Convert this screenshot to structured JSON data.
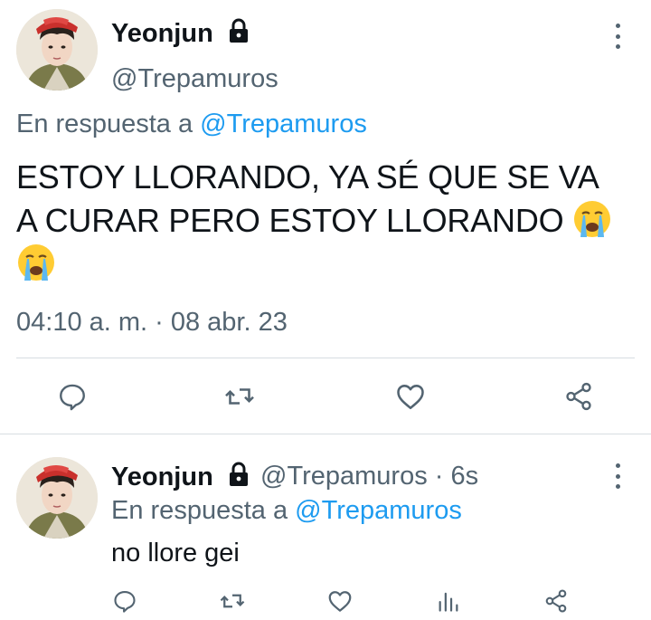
{
  "main_tweet": {
    "author_name": "Yeonjun",
    "author_handle": "@Trepamuros",
    "reply_prefix": "En respuesta a ",
    "reply_mention": "@Trepamuros",
    "text_line1": "ESTOY LLORANDO, YA SÉ QUE SE VA",
    "text_line2": "A CURAR PERO ESTOY LLORANDO",
    "timestamp": "04:10 a. m. · 08 abr. 23",
    "protected": true
  },
  "reply_tweet": {
    "author_name": "Yeonjun",
    "author_handle_time": "@Trepamuros · 6s",
    "reply_prefix": "En respuesta a ",
    "reply_mention": "@Trepamuros",
    "text": "no llore gei",
    "protected": true
  },
  "icons": {
    "more": "more-vertical-icon",
    "lock": "lock-icon",
    "reply": "reply-icon",
    "retweet": "retweet-icon",
    "like": "heart-icon",
    "views": "views-icon",
    "share": "share-icon",
    "emoji": "loudly-crying-face-emoji"
  },
  "colors": {
    "link": "#1d9bf0",
    "secondary_text": "#536471",
    "primary_text": "#0f1419",
    "divider": "#d7dde2"
  }
}
